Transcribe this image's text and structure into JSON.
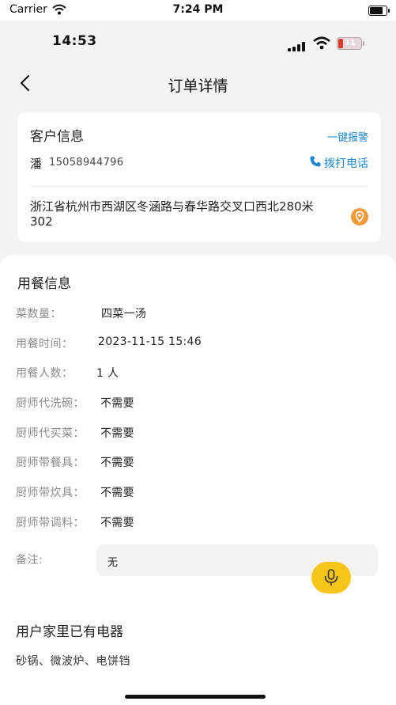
{
  "sim_status": {
    "carrier": "Carrier",
    "time": "7:24 PM"
  },
  "phone_status": {
    "time": "14:53",
    "battery": "11"
  },
  "nav": {
    "title": "订单详情"
  },
  "customer": {
    "title": "客户信息",
    "alarm_label": "一键报警",
    "name": "潘",
    "phone": "15058944796",
    "call_label": "拨打电话",
    "address": "浙江省杭州市西湖区冬涵路与春华路交叉口西北280米302",
    "accent_color": "#1c88d4",
    "location_color": "#f29a3a"
  },
  "meal": {
    "title": "用餐信息",
    "rows": [
      {
        "label": "菜数量：",
        "value": "四菜一汤"
      },
      {
        "label": "用餐时间：",
        "value": "2023-11-15 15:46"
      },
      {
        "label": "用餐人数：",
        "value": "1 人"
      },
      {
        "label": "厨师代洗碗：",
        "value": "不需要"
      },
      {
        "label": "厨师代买菜：",
        "value": "不需要"
      },
      {
        "label": "厨师带餐具：",
        "value": "不需要"
      },
      {
        "label": "厨师带炊具：",
        "value": "不需要"
      },
      {
        "label": "厨师带调料：",
        "value": "不需要"
      }
    ],
    "note_label": "备注:",
    "note_value": "无",
    "mic_color": "#f5c518"
  },
  "appliances": {
    "title": "用户家里已有电器",
    "list": "砂锅、微波炉、电饼铛"
  },
  "icons": [
    "wifi-icon",
    "battery-icon",
    "signal-icon",
    "back-arrow-icon",
    "phone-icon",
    "location-pin-icon",
    "microphone-icon"
  ]
}
